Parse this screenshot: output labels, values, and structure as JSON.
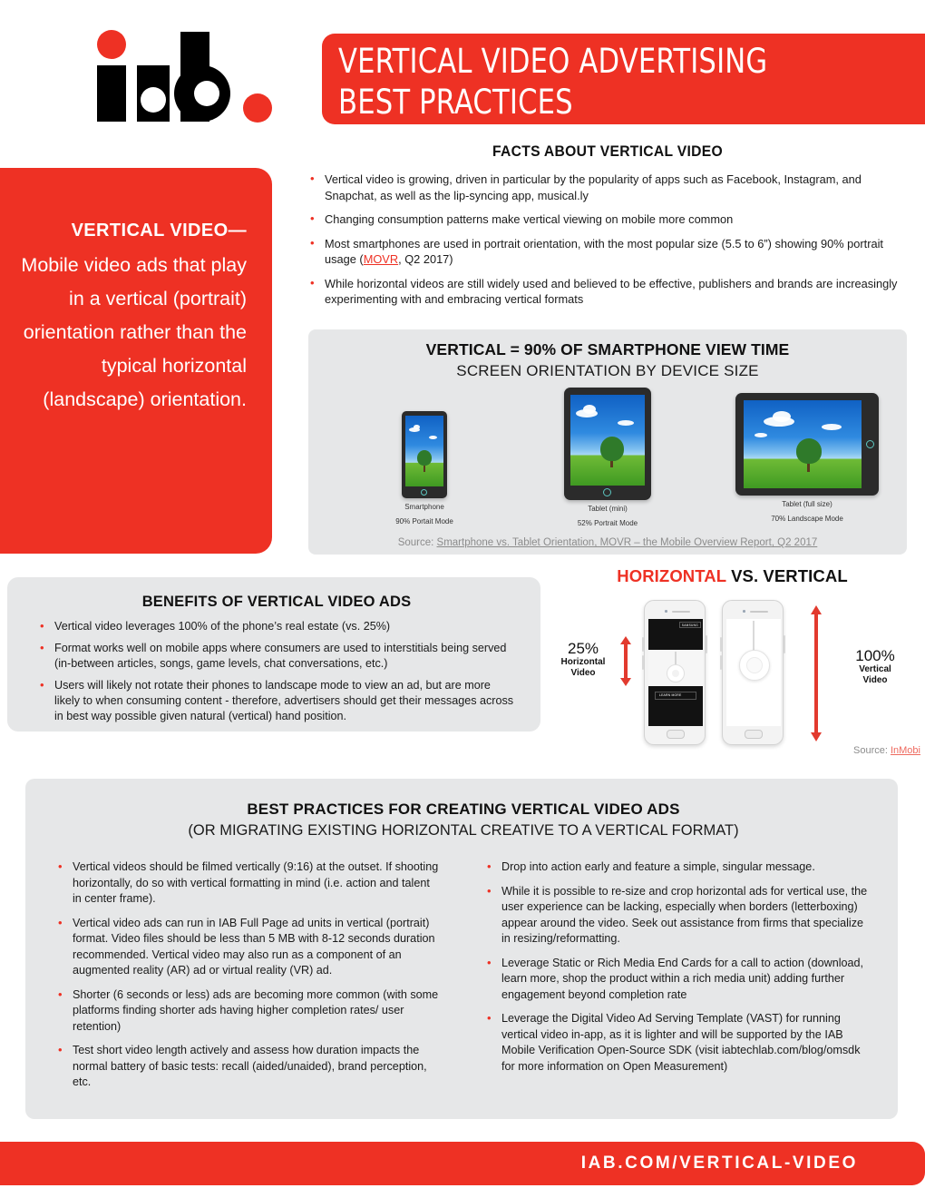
{
  "header": {
    "logo_alt": "iab",
    "title_line1": "VERTICAL VIDEO ADVERTISING",
    "title_line2": "BEST PRACTICES"
  },
  "definition_panel": {
    "heading": "VERTICAL VIDEO—",
    "body": "Mobile video ads that play in a vertical (portrait) orientation rather than the typical horizontal (landscape) orientation."
  },
  "facts": {
    "heading": "FACTS ABOUT VERTICAL VIDEO",
    "items": [
      "Vertical video is growing, driven in particular by the popularity of apps such as Facebook, Instagram, and Snapchat, as well as the lip-syncing app, musical.ly",
      "Changing consumption patterns make vertical viewing on mobile more common",
      "While horizontal videos are still widely used and believed to be effective, publishers and brands are increasingly experimenting with and embracing vertical formats"
    ],
    "item3_pre": "Most smartphones are used in portrait orientation, with the most popular size (5.5 to 6”) showing 90% portrait usage (",
    "item3_link": "MOVR",
    "item3_post": ", Q2 2017)"
  },
  "orientation": {
    "heading": "VERTICAL = 90% OF SMARTPHONE VIEW TIME",
    "subheading": "SCREEN ORIENTATION BY DEVICE SIZE",
    "devices": [
      {
        "name": "Smartphone",
        "stat": "90% Portait Mode"
      },
      {
        "name": "Tablet  (mini)",
        "stat": "52% Portrait Mode"
      },
      {
        "name": "Tablet (full size)",
        "stat": "70% Landscape Mode"
      }
    ],
    "source_prefix": "Source: ",
    "source_link": "Smartphone vs. Tablet Orientation, MOVR – the Mobile Overview Report, Q2 2017"
  },
  "benefits": {
    "heading": "BENEFITS OF VERTICAL VIDEO ADS",
    "items": [
      "Vertical video leverages 100% of the phone’s real estate (vs. 25%)",
      "Format works well on mobile apps where consumers are used to interstitials being served (in-between articles, songs, game levels, chat conversations, etc.)",
      "Users will likely not rotate their phones to landscape mode to view an ad, but are more likely to when consuming content - therefore, advertisers should get their messages across in best way possible given natural (vertical) hand position."
    ]
  },
  "comparison": {
    "heading_red": "HORIZONTAL",
    "heading_rest": " VS. VERTICAL",
    "left_pct": "25%",
    "left_label_1": "Horizontal",
    "left_label_2": "Video",
    "right_pct": "100%",
    "right_label_1": "Vertical",
    "right_label_2": "Video",
    "phone_brand": "SAMSUNG",
    "phone_cta": "LEARN MORE",
    "source_prefix": "Source: ",
    "source_link": "InMobi"
  },
  "best_practices": {
    "heading": "BEST PRACTICES FOR CREATING VERTICAL VIDEO ADS",
    "subheading": "(OR MIGRATING EXISTING HORIZONTAL CREATIVE TO A VERTICAL FORMAT)",
    "left_items": [
      "Vertical videos should be filmed vertically (9:16) at the outset. If shooting horizontally, do so with vertical formatting in mind (i.e. action and talent in center frame).",
      "Vertical video ads can run in IAB Full Page ad units in vertical (portrait) format. Video files should be less than 5 MB with 8-12 seconds duration recommended.  Vertical video may also run as a component of an augmented reality (AR) ad or virtual reality (VR) ad.",
      "Shorter (6 seconds or less) ads are becoming more common (with some platforms finding shorter ads having higher completion rates/ user retention)",
      "Test short video length actively and assess how duration impacts the normal battery of basic tests: recall (aided/unaided), brand perception, etc."
    ],
    "right_items": [
      "Drop into action early and feature a simple, singular message.",
      "While it is possible to re-size and crop horizontal ads for vertical use, the user experience can be lacking, especially when borders (letterboxing) appear around the video. Seek out assistance from firms that specialize in resizing/reformatting.",
      "Leverage Static or Rich Media End Cards for a call to action (download, learn more, shop the product within a rich media unit) adding further engagement beyond completion rate",
      "Leverage the Digital Video Ad Serving Template (VAST) for running vertical video in-app, as it is lighter and will be supported by the IAB Mobile Verification Open-Source SDK (visit iabtechlab.com/blog/omsdk for more information on Open Measurement)"
    ]
  },
  "footer": {
    "url": "IAB.COM/VERTICAL-VIDEO"
  },
  "colors": {
    "red": "#ee3124",
    "panel_gray": "#e6e7e8",
    "text_dark": "#1a1a1a",
    "muted": "#8c8c8c"
  }
}
